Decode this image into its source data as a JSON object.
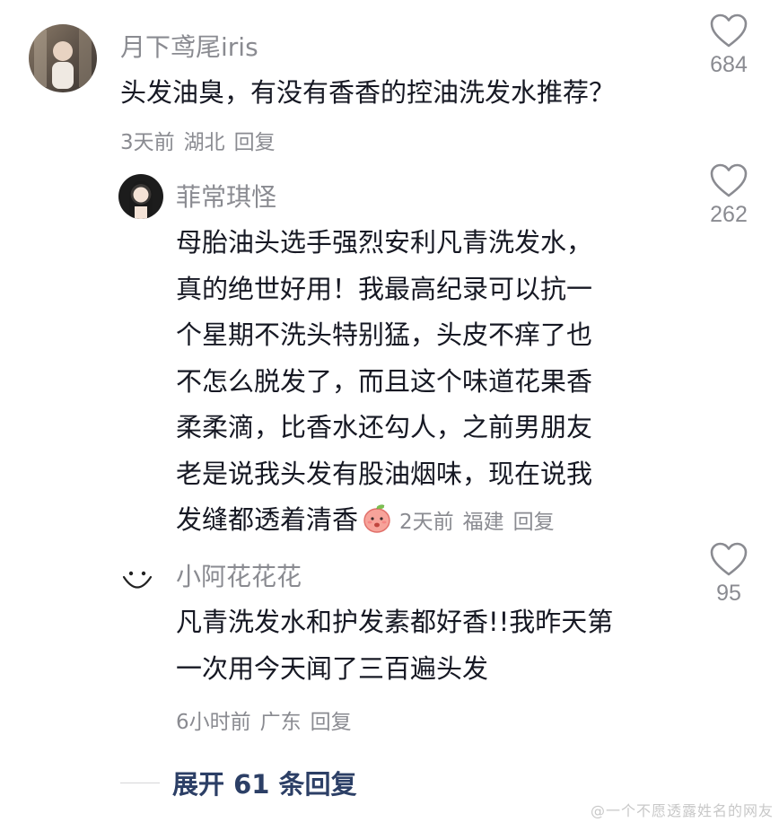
{
  "comments": [
    {
      "username": "月下鸢尾iris",
      "text_lines": [
        "头发油臭，有没有香香的控油洗发水推荐？"
      ],
      "time": "3天前",
      "location": "湖北",
      "reply_label": "回复",
      "likes": "684"
    },
    {
      "username": "菲常琪怪",
      "text_lines": [
        "母胎油头选手强烈安利凡青洗发水，",
        "真的绝世好用！我最高纪录可以抗一",
        "个星期不洗头特别猛，头皮不痒了也",
        "不怎么脱发了，而且这个味道花果香",
        "柔柔滴，比香水还勾人，之前男朋友",
        "老是说我头发有股油烟味，现在说我",
        "发缝都透着清香"
      ],
      "time": "2天前",
      "location": "福建",
      "reply_label": "回复",
      "likes": "262",
      "emoji": "peach-emoji"
    },
    {
      "username": "小阿花花花",
      "text_lines": [
        "凡青洗发水和护发素都好香!!我昨天第",
        "一次用今天闻了三百遍头发"
      ],
      "time": "6小时前",
      "location": "广东",
      "reply_label": "回复",
      "likes": "95"
    }
  ],
  "expand_label": "展开 61 条回复",
  "watermark": "@一个不愿透露姓名的网友",
  "colors": {
    "text": "#161823",
    "muted": "#8a8b91",
    "link": "#2c3f66"
  }
}
